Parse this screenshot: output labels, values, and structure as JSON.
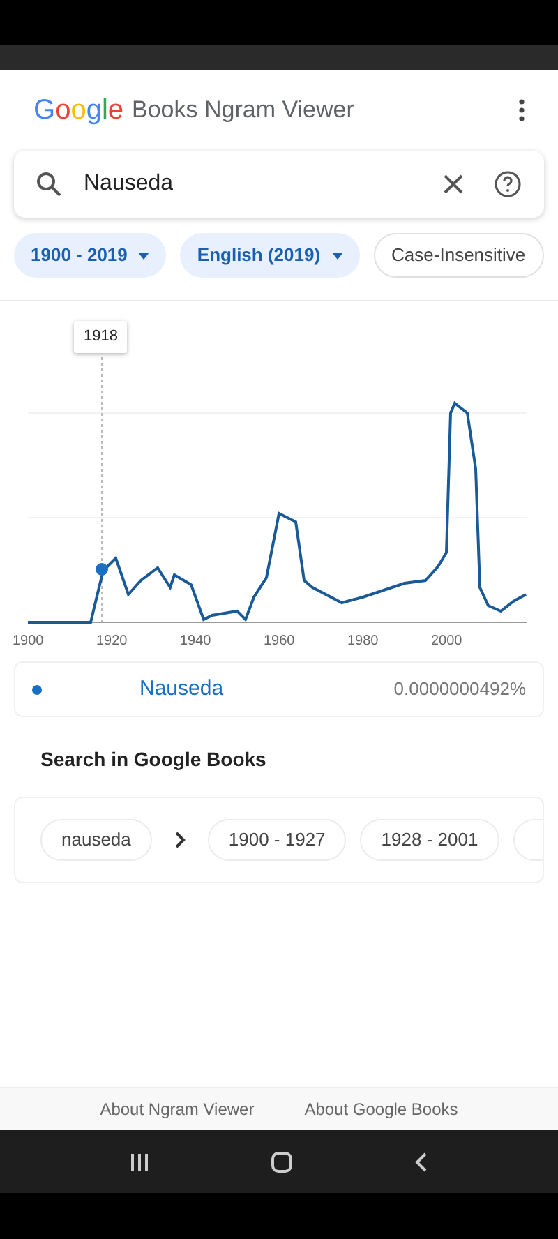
{
  "header": {
    "logo": "Google",
    "title": "Books Ngram Viewer"
  },
  "search": {
    "value": "Nauseda"
  },
  "chips": [
    {
      "label": "1900 - 2019",
      "kind": "dropdown"
    },
    {
      "label": "English (2019)",
      "kind": "dropdown"
    },
    {
      "label": "Case-Insensitive",
      "kind": "toggle"
    }
  ],
  "chart": {
    "tooltip": "1918",
    "x_axis_labels": [
      "1900",
      "1920",
      "1940",
      "1960",
      "1980",
      "2000"
    ]
  },
  "legend": {
    "name": "Nauseda",
    "color": "#1a6fc0",
    "value": "0.0000000492%"
  },
  "books": {
    "heading": "Search in Google Books",
    "term": "nauseda",
    "ranges": [
      "1900 - 1927",
      "1928 - 2001"
    ]
  },
  "footer": {
    "links": [
      "About Ngram Viewer",
      "About Google Books"
    ]
  }
}
